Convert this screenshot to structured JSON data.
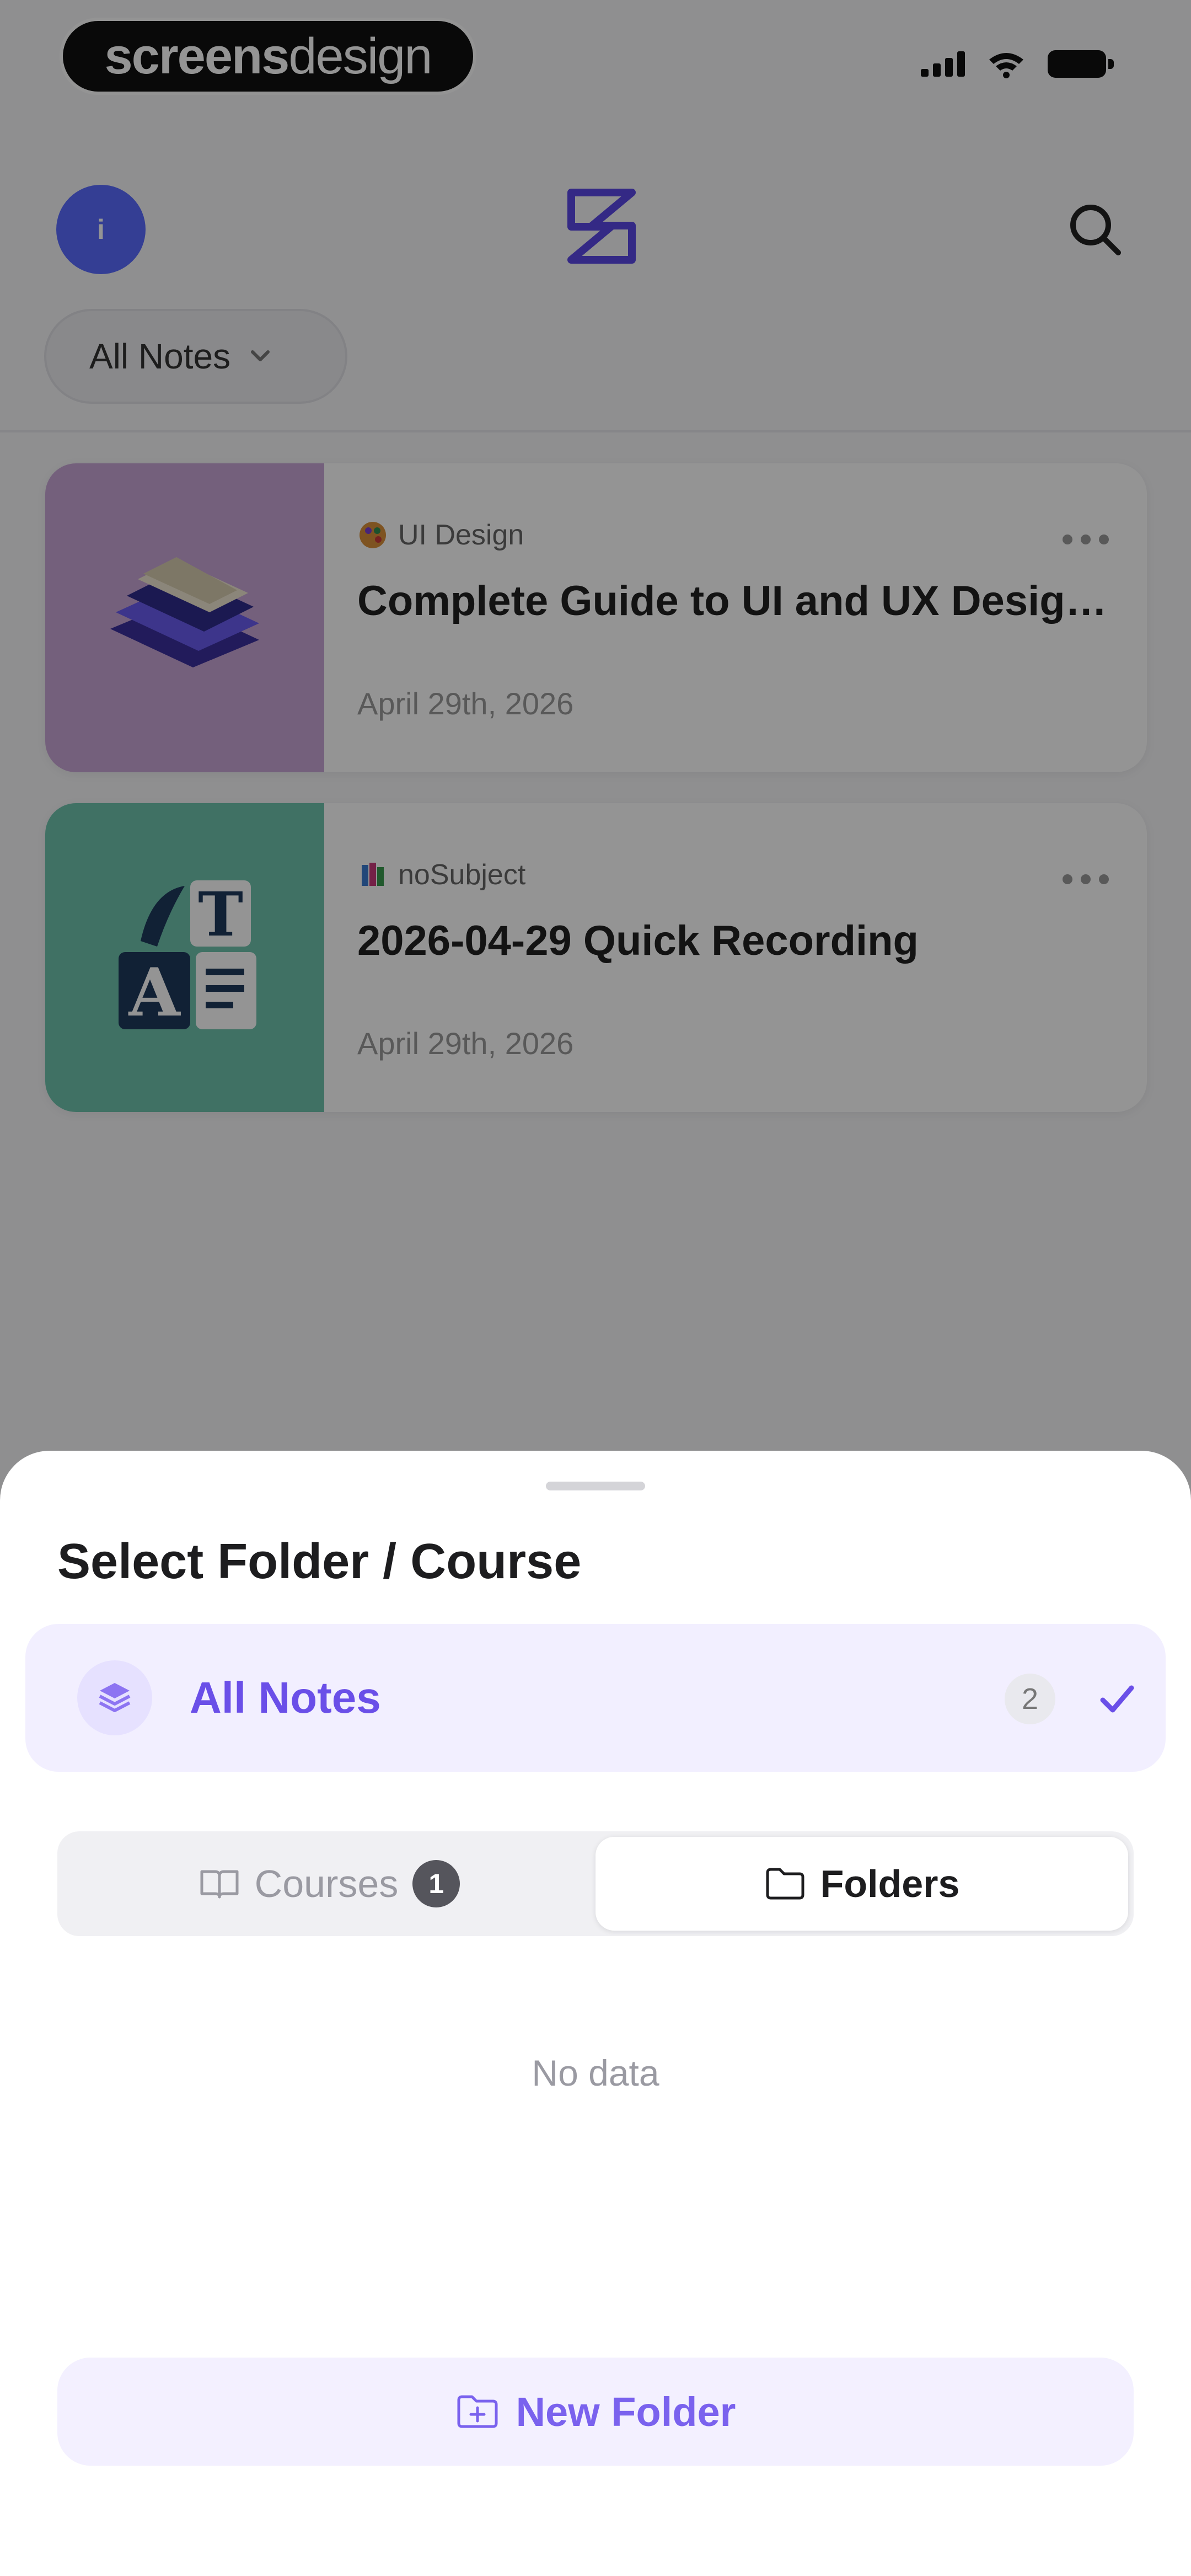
{
  "status_bar": {
    "brand_bold": "screens",
    "brand_light": "design"
  },
  "header": {
    "avatar_initial": "i",
    "filter_label": "All Notes"
  },
  "notes": [
    {
      "subject": "UI Design",
      "title": "Complete Guide to UI and UX Design Pr...",
      "date": "April 29th, 2026",
      "thumb_color": "#c9a6d6"
    },
    {
      "subject": "noSubject",
      "title": "2026-04-29 Quick Recording",
      "date": "April 29th, 2026",
      "thumb_color": "#6fc3ad"
    }
  ],
  "sheet": {
    "title": "Select Folder / Course",
    "all_notes": {
      "label": "All Notes",
      "count": "2"
    },
    "tabs": [
      {
        "label": "Courses",
        "badge": "1"
      },
      {
        "label": "Folders"
      }
    ],
    "empty_text": "No data",
    "new_folder_label": "New Folder"
  },
  "colors": {
    "accent": "#6a4fe8",
    "avatar": "#5b6cff",
    "overlay": "rgba(0,0,0,0.42)"
  }
}
